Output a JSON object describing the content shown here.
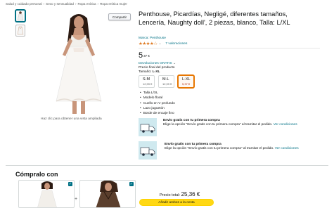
{
  "breadcrumb": [
    "Salud y cuidado personal",
    "Sexo y sensualidad",
    "Ropa erótica",
    "Ropa erótica mujer"
  ],
  "breadcrumb_separator": "›",
  "share_label": "Compartir",
  "zoom_hint": "Haz clic para obtener una vista ampliada",
  "product": {
    "title": "Penthouse, Picardías, Negligé, diferentes tamaños, Lencería, Naughty doll', 2 piezas, blanco, Talla: L/XL",
    "brand": "Marca: Penthouse",
    "stars": "★★★★☆",
    "rating_chevron": "⌄",
    "rating_count": "7 valoraciones",
    "price_whole": "5",
    "price_fraction": "37 €",
    "returns": "Devoluciones GRATIS",
    "returns_chevron": "⌄",
    "final_price_note": "Precio final del producto",
    "size_label": "Tamaño:",
    "size_value": "L-XL",
    "sizes": [
      {
        "name": "S-M",
        "price": "12,99 €"
      },
      {
        "name": "M-L",
        "price": "12,99 €"
      },
      {
        "name": "L-XL",
        "price": "5,37 €"
      }
    ],
    "selected_size_index": 2,
    "bullets": [
      "Talla L/XL",
      "Modelo floral",
      "Cuello en V profundo",
      "Lazo juguetón",
      "Borde de encaje fino"
    ]
  },
  "shipping_promos": [
    {
      "title": "Envío gratis con tu primera compra",
      "text": "Elige la opción \"Envío gratis con tu primera compra\" al tramitar el pedido.",
      "link": "Ver condiciones"
    },
    {
      "title": "Envío gratis con tu primera compra",
      "text": "Elige la opción \"Envío gratis con tu primera compra\" al tramitar el pedido.",
      "link": "Ver condiciones"
    }
  ],
  "bundle": {
    "heading": "Cómpralo con",
    "plus": "+",
    "check": "✓",
    "total_label": "Precio total:",
    "total_value": "25,36 €",
    "add_button": "Añadir ambos a la cesta"
  },
  "colors": {
    "link": "#007185",
    "star": "#de7921",
    "button": "#ffd814",
    "selected": "#e77600"
  }
}
